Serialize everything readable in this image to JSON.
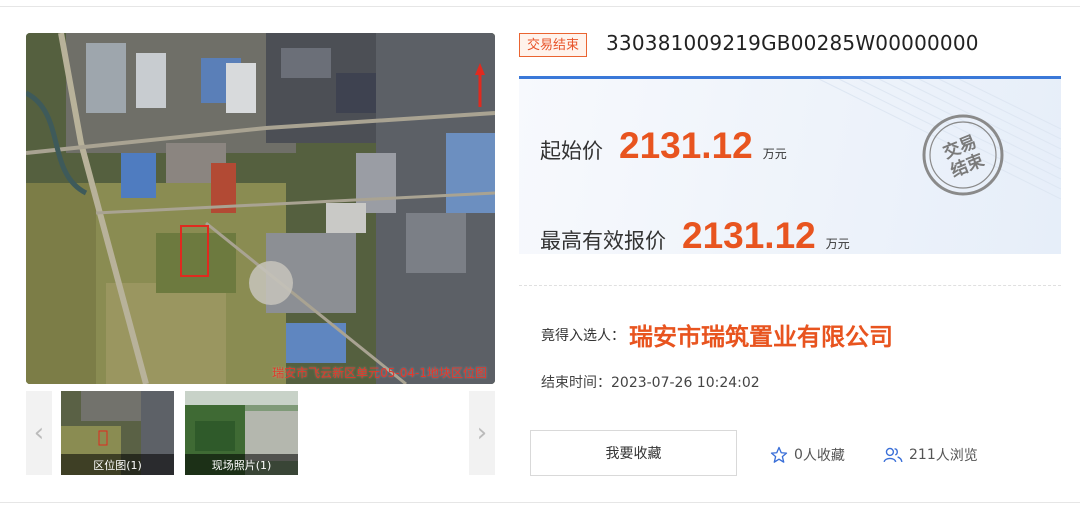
{
  "gallery": {
    "map_caption": "瑞安市飞云新区单元05-04-1地块区位图",
    "prev_label": "‹",
    "next_label": "›",
    "thumbnails": [
      {
        "label": "区位图(1)"
      },
      {
        "label": "现场照片(1)"
      }
    ]
  },
  "listing": {
    "status_tag": "交易结束",
    "lot_code": "330381009219GB00285W00000000",
    "stamp_text": "交易结束",
    "start_price": {
      "label": "起始价",
      "value": "2131.12",
      "unit": "万元"
    },
    "highest_price": {
      "label": "最高有效报价",
      "value": "2131.12",
      "unit": "万元"
    },
    "winner": {
      "label": "竟得入选人：",
      "value": "瑞安市瑞筑置业有限公司"
    },
    "end_time": "结束时间：2023-07-26 10:24:02"
  },
  "actions": {
    "favorite_button": "我要收藏",
    "favorites_count": "0",
    "favorites_suffix": "人收藏",
    "views_count": "211",
    "views_suffix": "人浏览"
  },
  "colors": {
    "accent_orange": "#e8541f",
    "accent_blue": "#3a78d8",
    "icon_blue": "#3a6fd8"
  }
}
